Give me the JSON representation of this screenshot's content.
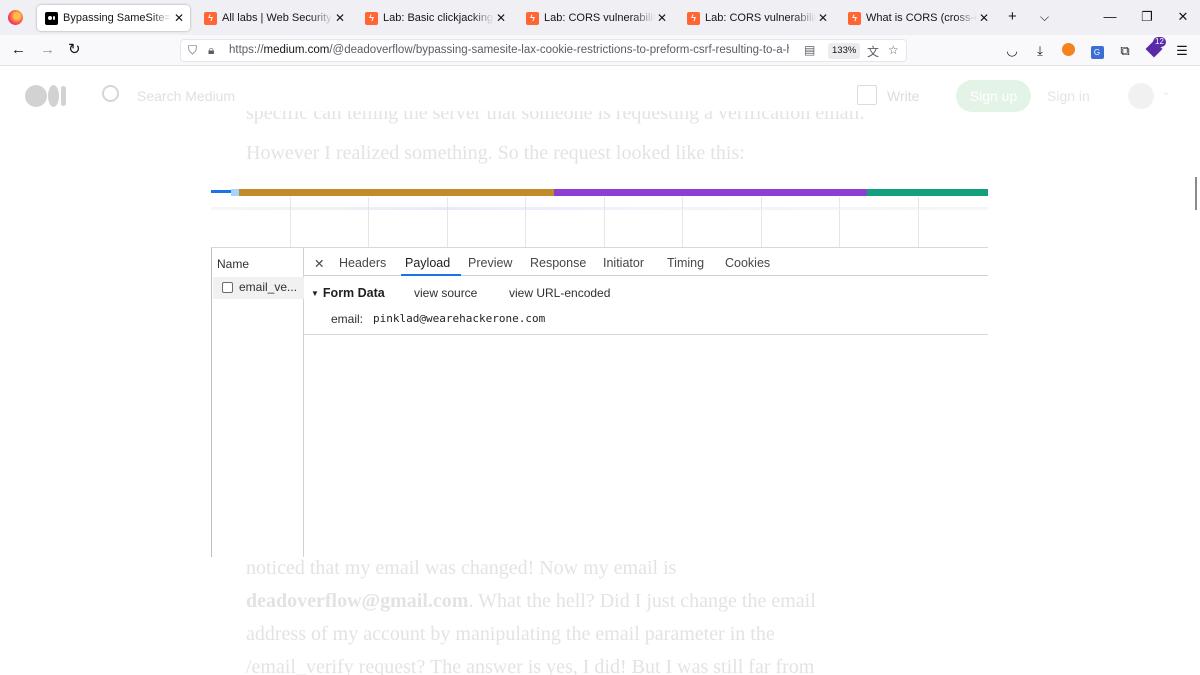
{
  "tabs": [
    {
      "label": "Bypassing SameSite=lax cookie restrictions to preform",
      "favicon": "medium-icon",
      "active": true
    },
    {
      "label": "All labs | Web Security Academy",
      "favicon": "portswigger-icon",
      "active": false
    },
    {
      "label": "Lab: Basic clickjacking with CSRF token protection",
      "favicon": "portswigger-icon",
      "active": false
    },
    {
      "label": "Lab: CORS vulnerability with basic origin reflection",
      "favicon": "portswigger-icon",
      "active": false
    },
    {
      "label": "Lab: CORS vulnerability with trusted null origin",
      "favicon": "portswigger-icon",
      "active": false
    },
    {
      "label": "What is CORS (cross-origin resource sharing)?",
      "favicon": "portswigger-icon",
      "active": false
    }
  ],
  "toolbar": {
    "url_prefix": "https://",
    "url_host": "medium.com",
    "url_path": "/@deadoverflow/bypassing-samesite-lax-cookie-restrictions-to-preform-csrf-resulting-to-a-horizontal",
    "zoom": "133%",
    "notification_count": "12"
  },
  "medium": {
    "search_placeholder": "Search Medium",
    "write_label": "Write",
    "signup_label": "Sign up",
    "signin_label": "Sign in"
  },
  "article": {
    "text_top_1": "specific call telling the server that someone is requesting a verification email.",
    "text_top_2": "However I realized something. So the request looked like this:",
    "text_bottom_1": "noticed that my email was changed! Now my email is",
    "text_bottom_2_bold": "deadoverflow@gmail.com",
    "text_bottom_2_rest": ". What the hell? Did I just change the email",
    "text_bottom_3": "address of my account by manipulating the email parameter in the",
    "text_bottom_4": "/email_verify request? The answer is yes, I did! But I was still far from"
  },
  "devtools": {
    "name_header": "Name",
    "request_name": "email_ve...",
    "tabs": [
      "Headers",
      "Payload",
      "Preview",
      "Response",
      "Initiator",
      "Timing",
      "Cookies"
    ],
    "selected_tab": "Payload",
    "form_data_title": "Form Data",
    "view_source": "view source",
    "view_url_encoded": "view URL-encoded",
    "field_key": "email:",
    "field_value": "pinklad@wearehackerone.com"
  },
  "colors": {
    "waterfall_orange": "#c18a2b",
    "waterfall_purple": "#8e3ed3",
    "waterfall_teal": "#14a07c",
    "tab_underline": "#1a73e8",
    "medium_signup": "#e3f3e5"
  }
}
